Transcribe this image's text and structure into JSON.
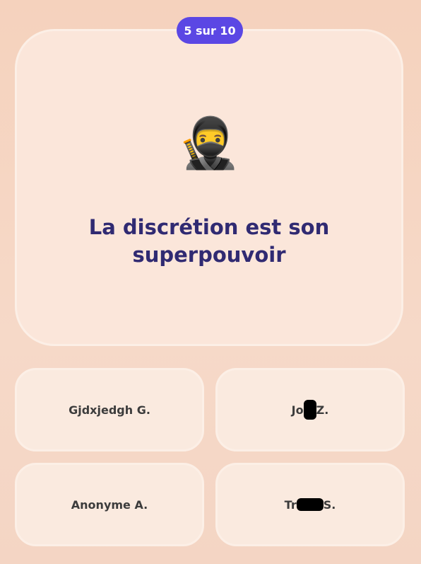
{
  "progress": {
    "label": "5 sur 10",
    "current": 5,
    "total": 10
  },
  "question": {
    "emoji": "🥷",
    "emoji_icon": "ninja-icon",
    "text": "La discrétion est son superpouvoir"
  },
  "answers": [
    {
      "label": "Gjdxjedgh G."
    },
    {
      "prefix": "Jo",
      "suffix": " Z.",
      "redacted": true
    },
    {
      "label": "Anonyme A."
    },
    {
      "prefix": "Tr",
      "suffix": "S.",
      "redacted": true
    }
  ],
  "colors": {
    "accent": "#5b47e4",
    "question_text": "#302a72",
    "card": "#fbe6da",
    "background": "#f5d2bd"
  }
}
